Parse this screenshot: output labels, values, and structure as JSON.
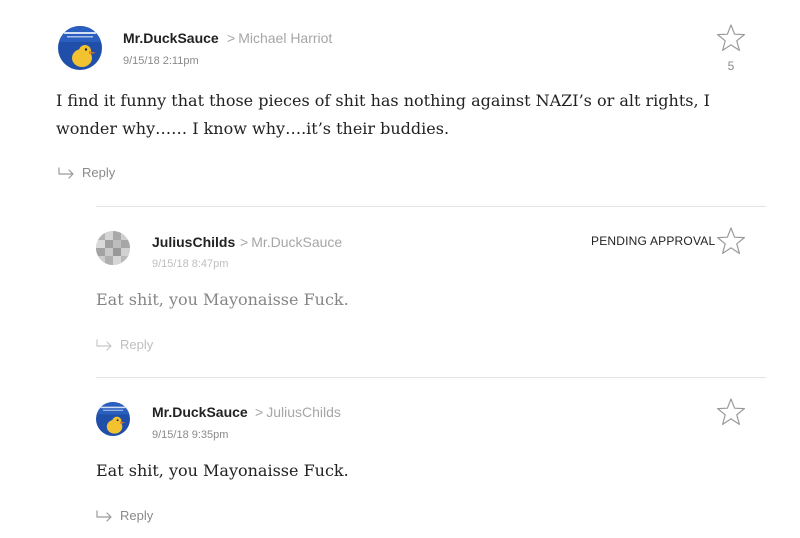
{
  "comments": [
    {
      "author": "Mr.DuckSauce",
      "reply_to": "Michael Harriot",
      "timestamp": "9/15/18 2:11pm",
      "body": "I find it funny that those pieces of shit has nothing against NAZI’s or alt rights, I wonder why…… I know why….it’s their buddies.",
      "star_count": "5",
      "reply_label": "Reply",
      "avatar_icon": "duck-avatar"
    },
    {
      "author": "JuliusChilds",
      "reply_to": "Mr.DuckSauce",
      "timestamp": "9/15/18 8:47pm",
      "body": "Eat shit, you Mayonaisse Fuck.",
      "status": "PENDING APPROVAL",
      "reply_label": "Reply",
      "avatar_icon": "pixelated-avatar"
    },
    {
      "author": "Mr.DuckSauce",
      "reply_to": "JuliusChilds",
      "timestamp": "9/15/18 9:35pm",
      "body": "Eat shit, you Mayonaisse Fuck.",
      "reply_label": "Reply",
      "avatar_icon": "duck-avatar"
    }
  ],
  "reply_to_separator": ">",
  "colors": {
    "text": "#222222",
    "muted": "#8a8a8a",
    "reply_to": "#a6a6a6",
    "divider": "#e4e4e4",
    "avatar_bg": "#1f4fa8"
  }
}
